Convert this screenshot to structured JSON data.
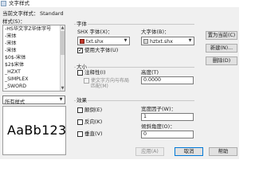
{
  "window": {
    "title": "文字样式"
  },
  "current_style": {
    "label": "当前文字样式：",
    "value": "Standard"
  },
  "styles": {
    "label": "样式(S)：",
    "items": [
      "-HS华文字Z华体字号",
      "-宋体",
      "-宋体",
      "-宋体",
      "$0$-宋体",
      "$2$宋体",
      "_HZXT",
      "_SIMPLEX",
      "_SWORD"
    ]
  },
  "filter": {
    "value": "所有样式"
  },
  "font": {
    "group_label": "字体",
    "shx_label": "SHX 字体(X)：",
    "shx_value": "txt.shx",
    "big_font_label": "大字体(B)：",
    "big_font_value": "hztxt.shx",
    "use_big_font_label": "使用大字体(U)",
    "use_big_font_checked": true
  },
  "size": {
    "group_label": "大小",
    "annotative_label": "注释性(I)",
    "annotative_checked": false,
    "match_orientation_label": "使文字方向与布局匹配(M)",
    "height_label": "高度(T)",
    "height_value": "0.0000"
  },
  "effects": {
    "group_label": "效果",
    "upside_down_label": "颠倒(E)",
    "backwards_label": "反向(K)",
    "vertical_label": "垂直(V)",
    "width_factor_label": "宽度因子(W)：",
    "width_factor_value": "1",
    "oblique_label": "倾斜角度(O)：",
    "oblique_value": "0"
  },
  "buttons": {
    "set_current": "置为当前(C)",
    "new": "新建(N)...",
    "delete": "删除(D)",
    "apply": "应用(A)",
    "cancel": "取消",
    "help": "帮助"
  },
  "preview": {
    "sample": "AaBb123"
  }
}
